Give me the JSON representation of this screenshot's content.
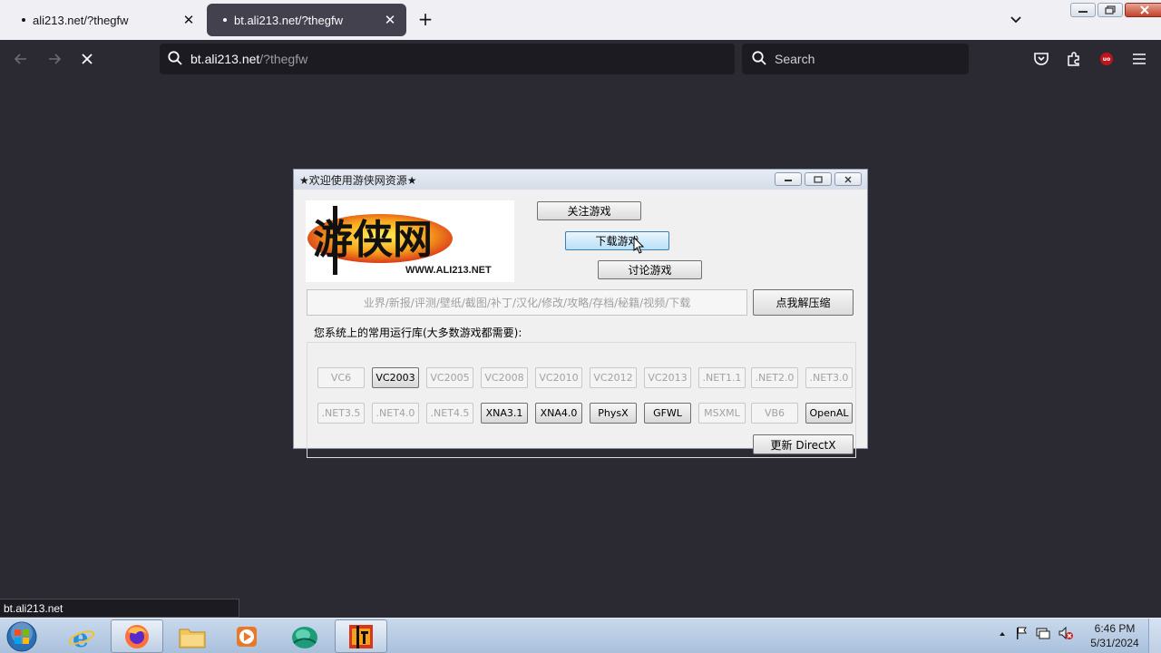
{
  "browser": {
    "tabs": [
      {
        "title": "ali213.net/?thegfw"
      },
      {
        "title": "bt.ali213.net/?thegfw"
      }
    ],
    "url_host": "bt.ali213.net",
    "url_path": "/?thegfw",
    "search_placeholder": "Search",
    "status_url": "bt.ali213.net",
    "extension_badge": "uo"
  },
  "dialog": {
    "title": "★欢迎使用游侠网资源★",
    "logo_text": "WWW.ALI213.NET",
    "logo_glyphs": "游侠网",
    "follow_label": "关注游戏",
    "download_label": "下载游戏",
    "discuss_label": "讨论游戏",
    "links_text": "业界/新报/评测/壁纸/截图/补丁/汉化/修改/攻略/存档/秘籍/视频/下载",
    "extract_label": "点我解压缩",
    "runtime_group_label": "您系统上的常用运行库(大多数游戏都需要):",
    "runtimes_row1": [
      {
        "label": "VC6",
        "enabled": false
      },
      {
        "label": "VC2003",
        "enabled": true
      },
      {
        "label": "VC2005",
        "enabled": false
      },
      {
        "label": "VC2008",
        "enabled": false
      },
      {
        "label": "VC2010",
        "enabled": false
      },
      {
        "label": "VC2012",
        "enabled": false
      },
      {
        "label": "VC2013",
        "enabled": false
      },
      {
        "label": ".NET1.1",
        "enabled": false
      },
      {
        "label": ".NET2.0",
        "enabled": false
      },
      {
        "label": ".NET3.0",
        "enabled": false
      }
    ],
    "runtimes_row2": [
      {
        "label": ".NET3.5",
        "enabled": false
      },
      {
        "label": ".NET4.0",
        "enabled": false
      },
      {
        "label": ".NET4.5",
        "enabled": false
      },
      {
        "label": "XNA3.1",
        "enabled": true
      },
      {
        "label": "XNA4.0",
        "enabled": true
      },
      {
        "label": "PhysX",
        "enabled": true
      },
      {
        "label": "GFWL",
        "enabled": true
      },
      {
        "label": "MSXML",
        "enabled": false
      },
      {
        "label": "VB6",
        "enabled": false
      },
      {
        "label": "OpenAL",
        "enabled": true
      }
    ],
    "directx_label": "更新 DirectX"
  },
  "taskbar": {
    "time": "6:46 PM",
    "date": "5/31/2024"
  }
}
